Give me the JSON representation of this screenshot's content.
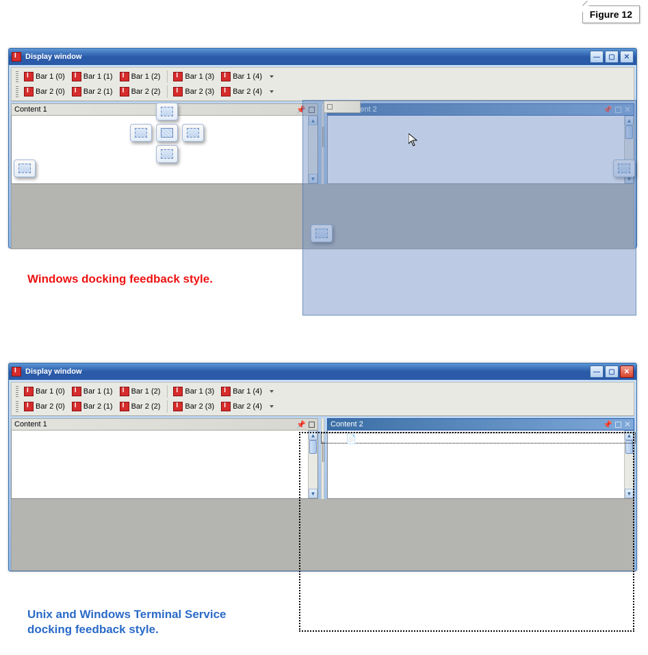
{
  "figure_label": "Figure 12",
  "window_title": "Display window",
  "toolbar_row1": [
    "Bar 1 (0)",
    "Bar 1 (1)",
    "Bar 1 (2)",
    "Bar 1 (3)",
    "Bar 1 (4)"
  ],
  "toolbar_row2": [
    "Bar 2 (0)",
    "Bar 2 (1)",
    "Bar 2 (2)",
    "Bar 2 (3)",
    "Bar 2 (4)"
  ],
  "pane1_title": "Content 1",
  "pane2_title": "Content 2",
  "pane2_partial_label": "ontent 2",
  "caption_windows": "Windows docking feedback  style.",
  "caption_unix": "Unix and Windows Terminal Service\ndocking feedback style."
}
